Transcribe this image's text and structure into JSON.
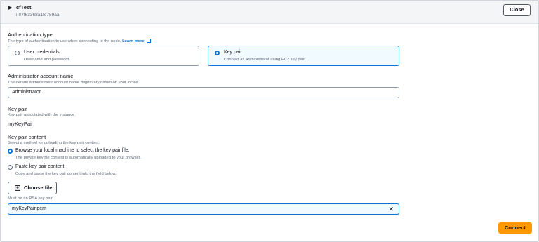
{
  "header": {
    "instance_name": "cfTest",
    "instance_id": "i-07f63368a1fe759aa",
    "close_label": "Close"
  },
  "auth": {
    "title": "Authentication type",
    "description": "The type of authentication to use when connecting to the node.",
    "learn_more": "Learn more",
    "options": [
      {
        "label": "User credentials",
        "description": "Username and password.",
        "selected": false
      },
      {
        "label": "Key pair",
        "description": "Connect as Administrator using EC2 key pair.",
        "selected": true
      }
    ]
  },
  "admin": {
    "title": "Administrator account name",
    "description": "The default administrator account name might vary based on your locale.",
    "value": "Administrator"
  },
  "keypair": {
    "title": "Key pair",
    "description": "Key pair associated with the instance",
    "value": "myKeyPair"
  },
  "content": {
    "title": "Key pair content",
    "description": "Select a method for uploading the key pair content.",
    "options": [
      {
        "label": "Browse your local machine to select the key pair file.",
        "description": "The private key file content is automatically uploaded to your browser.",
        "selected": true
      },
      {
        "label": "Paste key pair content",
        "description": "Copy and paste the key pair content into the field below.",
        "selected": false
      }
    ],
    "choose_file_label": "Choose file",
    "hint": "Must be an RSA key pair.",
    "file_value": "myKeyPair.pem"
  },
  "footer": {
    "connect_label": "Connect"
  },
  "colors": {
    "accent": "#0972d3",
    "primary_button": "#ff9900"
  },
  "icons": [
    "caret-right-icon",
    "external-link-icon",
    "upload-icon",
    "clear-icon"
  ]
}
